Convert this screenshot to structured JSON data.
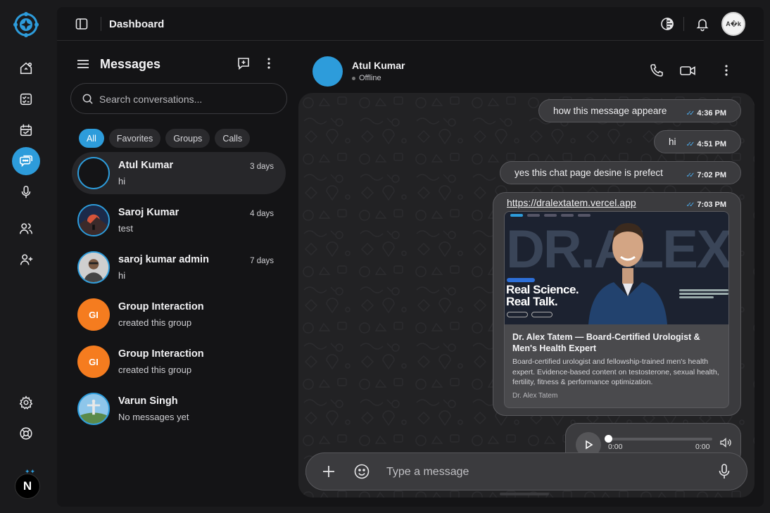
{
  "topbar": {
    "title": "Dashboard",
    "user_avatar_text": "A�k"
  },
  "sidebar": {
    "items": [
      {
        "name": "home",
        "icon": "home-icon"
      },
      {
        "name": "tasks",
        "icon": "checklist-icon"
      },
      {
        "name": "calendar",
        "icon": "calendar-icon"
      },
      {
        "name": "messages",
        "icon": "chat-icon",
        "active": true
      },
      {
        "name": "voice",
        "icon": "microphone-icon"
      },
      {
        "name": "users",
        "icon": "users-icon"
      },
      {
        "name": "add-user",
        "icon": "user-plus-icon"
      },
      {
        "name": "settings",
        "icon": "gear-icon"
      },
      {
        "name": "help",
        "icon": "lifebuoy-icon"
      }
    ],
    "bottom_avatar": "N"
  },
  "conversations": {
    "heading": "Messages",
    "search_placeholder": "Search conversations...",
    "filters": [
      "All",
      "Favorites",
      "Groups",
      "Calls"
    ],
    "active_filter": "All",
    "items": [
      {
        "name": "Atul Kumar",
        "message": "hi",
        "time": "3 days",
        "avatar": "",
        "active": true
      },
      {
        "name": "Saroj Kumar",
        "message": "test",
        "time": "4 days",
        "avatar": ""
      },
      {
        "name": "saroj kumar admin",
        "message": "hi",
        "time": "7 days",
        "avatar": ""
      },
      {
        "name": "Group Interaction",
        "message": "created this group",
        "time": "",
        "avatar": "GI"
      },
      {
        "name": "Group Interaction",
        "message": "created this group",
        "time": "",
        "avatar": "GI"
      },
      {
        "name": "Varun Singh",
        "message": "No messages yet",
        "time": "",
        "avatar": ""
      }
    ]
  },
  "chat": {
    "contact_name": "Atul Kumar",
    "status": "Offline",
    "messages": [
      {
        "text": "how this message appeare",
        "time": "4:36 PM"
      },
      {
        "text": "hi",
        "time": "4:51 PM"
      },
      {
        "text": "yes this chat page desine is prefect",
        "time": "7:02 PM"
      }
    ],
    "link_message": {
      "url": "https://dralextatem.vercel.app",
      "time": "7:03 PM",
      "preview": {
        "hero_text": "DR.ALEX",
        "tagline_1": "Real Science.",
        "tagline_2": "Real Talk.",
        "title": "Dr. Alex Tatem — Board-Certified Urologist & Men's Health Expert",
        "description": "Board-certified urologist and fellowship-trained men's health expert. Evidence-based content on testosterone, sexual health, fertility, fitness & performance optimization.",
        "site": "Dr. Alex Tatem"
      }
    },
    "audio": {
      "current": "0:00",
      "duration": "0:00",
      "progress": 0
    },
    "composer_placeholder": "Type a message"
  },
  "colors": {
    "accent": "#2d9cdb",
    "group_avatar": "#f57c1f",
    "bubble": "#3b3b3e"
  }
}
